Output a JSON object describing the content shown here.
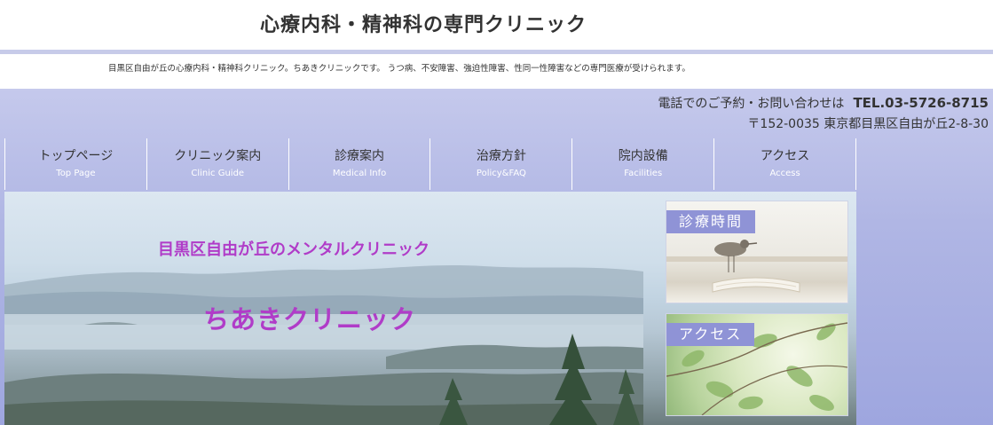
{
  "header": {
    "title": "心療内科・精神科の専門クリニック",
    "description": "目黒区自由が丘の心療内科・精神科クリニック。ちあきクリニックです。 うつ病、不安障害、強迫性障害、性同一性障害などの専門医療が受けられます。"
  },
  "contact": {
    "label": "電話でのご予約・お問い合わせは",
    "tel": "TEL.03-5726-8715",
    "address": "〒152-0035 東京都目黒区自由が丘2-8-30"
  },
  "nav": [
    {
      "jp": "トップページ",
      "en": "Top Page"
    },
    {
      "jp": "クリニック案内",
      "en": "Clinic Guide"
    },
    {
      "jp": "診療案内",
      "en": "Medical Info"
    },
    {
      "jp": "治療方針",
      "en": "Policy&FAQ"
    },
    {
      "jp": "院内設備",
      "en": "Facilities"
    },
    {
      "jp": "アクセス",
      "en": "Access"
    }
  ],
  "hero": {
    "subtitle": "目黒区自由が丘のメンタルクリニック",
    "clinic_name": "ちあきクリニック"
  },
  "banners": {
    "hours": "診療時間",
    "access": "アクセス"
  },
  "colors": {
    "accent": "#b03cc8",
    "band": "#b0b6e4",
    "banner_label": "#8f93d6"
  }
}
